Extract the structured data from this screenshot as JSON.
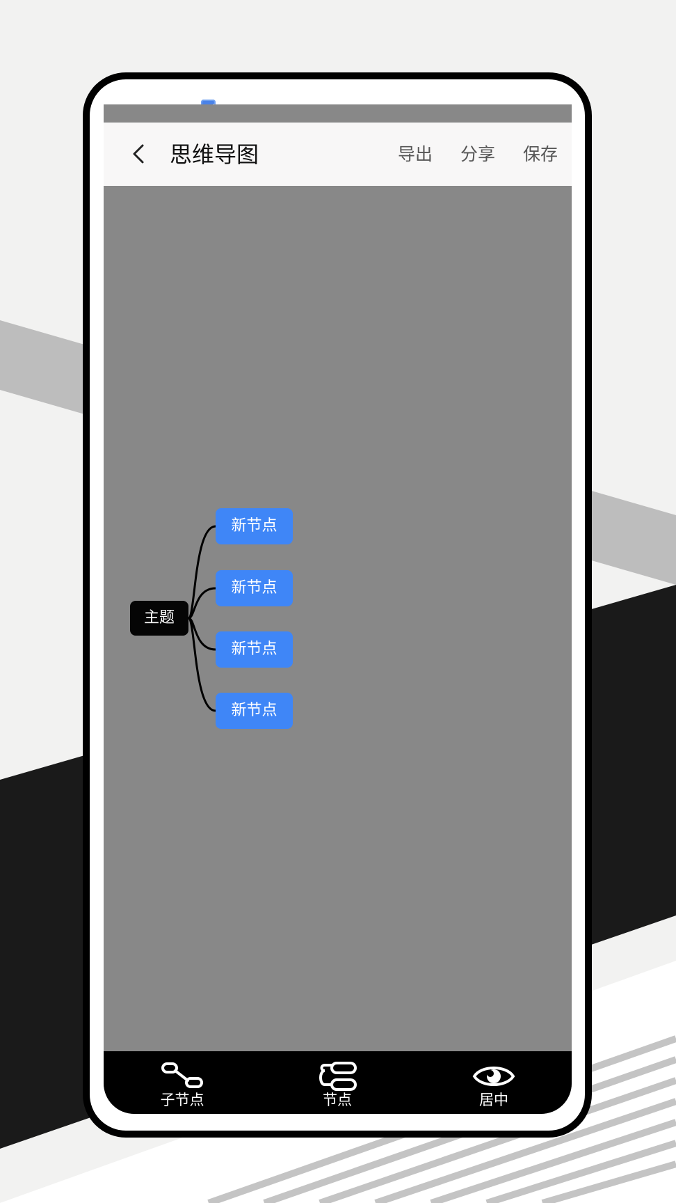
{
  "appbar": {
    "title": "思维导图",
    "export_label": "导出",
    "share_label": "分享",
    "save_label": "保存"
  },
  "mindmap": {
    "root": "主题",
    "children": [
      "新节点",
      "新节点",
      "新节点",
      "新节点"
    ]
  },
  "toolbar": {
    "items": [
      {
        "label": "子节点",
        "icon": "child-node-icon"
      },
      {
        "label": "节点",
        "icon": "node-icon"
      },
      {
        "label": "居中",
        "icon": "eye-icon"
      }
    ]
  },
  "colors": {
    "canvas": "#888888",
    "child_node": "#3f86f7",
    "root_node": "#050505",
    "toolbar": "#000000"
  }
}
